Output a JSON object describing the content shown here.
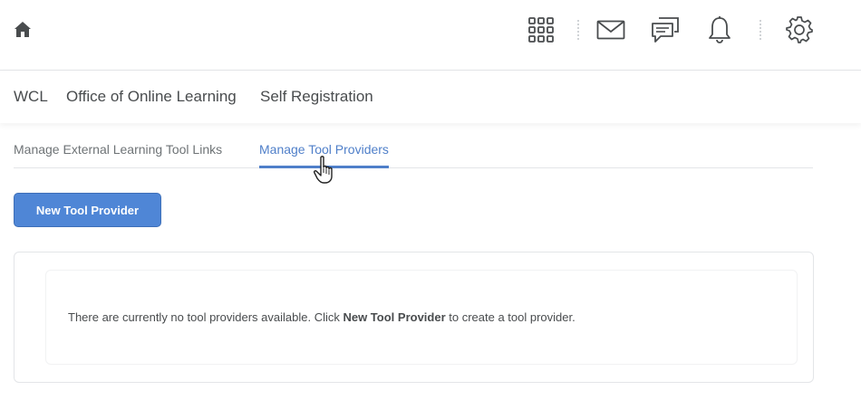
{
  "topbar": {
    "home_icon": "home-icon",
    "icons": [
      "grid-icon",
      "mail-icon",
      "chat-icon",
      "bell-icon",
      "gear-icon"
    ]
  },
  "nav": {
    "items": [
      {
        "label": "WCL"
      },
      {
        "label": "Office of Online Learning"
      },
      {
        "label": "Self Registration"
      }
    ]
  },
  "tabs": [
    {
      "label": "Manage External Learning Tool Links",
      "active": false
    },
    {
      "label": "Manage Tool Providers",
      "active": true
    }
  ],
  "actions": {
    "new_button_label": "New Tool Provider"
  },
  "empty_state": {
    "text_before": "There are currently no tool providers available. Click ",
    "emphasis": "New Tool Provider",
    "text_after": " to create a tool provider."
  },
  "colors": {
    "accent": "#4f7fc9",
    "button": "#4f86d6"
  }
}
